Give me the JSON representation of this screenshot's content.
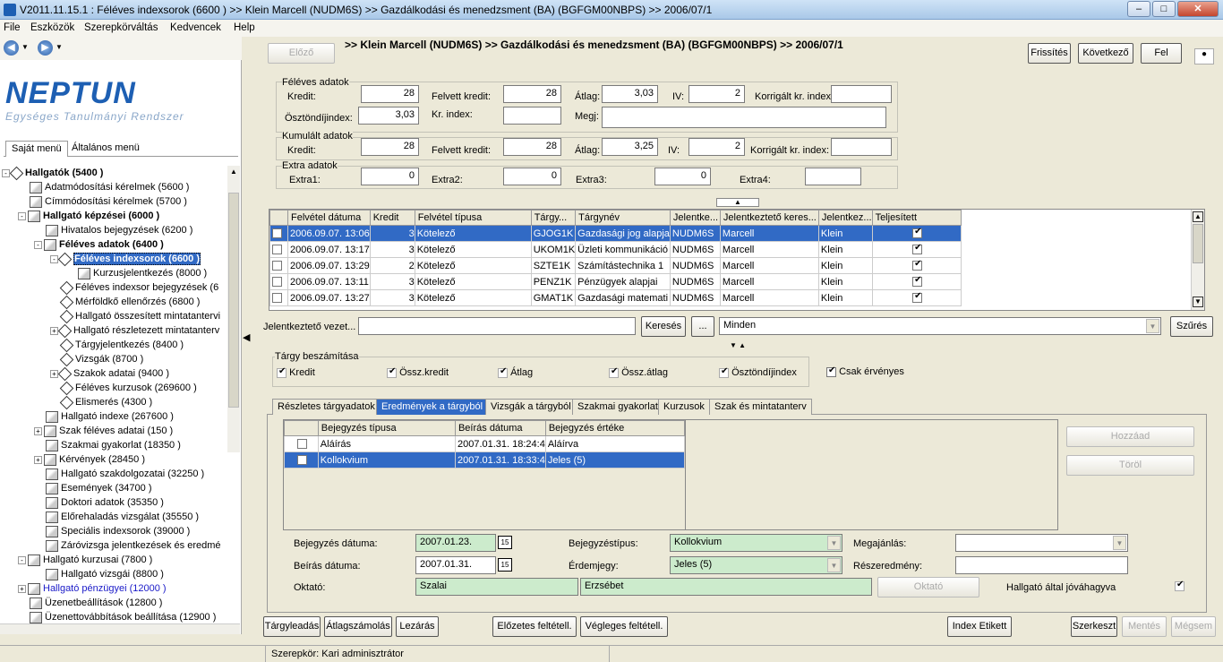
{
  "window": {
    "title": "V2011.11.15.1 : Féléves indexsorok (6600  )  >> Klein Marcell (NUDM6S)  >> Gazdálkodási és menedzsment (BA) (BGFGM00NBPS)  >> 2006/07/1"
  },
  "menu": [
    "File",
    "Eszközök",
    "Szerepkörváltás",
    "Kedvencek",
    "Help"
  ],
  "logo": {
    "name": "NEPTUN",
    "subtitle": "Egységes Tanulmányi Rendszer"
  },
  "left_tabs": [
    "Saját menü",
    "Általános menü"
  ],
  "tree": [
    {
      "label": "Hallgatók (5400  )",
      "level": 0,
      "bold": true,
      "icon": "diamond",
      "exp": "-"
    },
    {
      "label": "Adatmódosítási kérelmek (5600  )",
      "level": 1,
      "icon": "doc"
    },
    {
      "label": "Címmódosítási kérelmek (5700  )",
      "level": 1,
      "icon": "doc"
    },
    {
      "label": "Hallgató képzései (6000  )",
      "level": 1,
      "bold": true,
      "icon": "doc",
      "exp": "-"
    },
    {
      "label": "Hivatalos bejegyzések (6200  )",
      "level": 2,
      "icon": "doc"
    },
    {
      "label": "Féléves adatok (6400  )",
      "level": 2,
      "bold": true,
      "icon": "doc",
      "exp": "-"
    },
    {
      "label": "Féléves indexsorok (6600  )",
      "level": 3,
      "bold": true,
      "sel": true,
      "icon": "diamond",
      "exp": "-"
    },
    {
      "label": "Kurzusjelentkezés (8000  )",
      "level": 4,
      "icon": "doc"
    },
    {
      "label": "Féléves indexsor bejegyzések (6",
      "level": 3,
      "icon": "diamond"
    },
    {
      "label": "Mérföldkő ellenőrzés (6800  )",
      "level": 3,
      "icon": "diamond"
    },
    {
      "label": "Hallgató összesített mintatantervi",
      "level": 3,
      "icon": "diamond"
    },
    {
      "label": "Hallgató részletezett mintatanterv",
      "level": 3,
      "icon": "diamond",
      "exp": "+"
    },
    {
      "label": "Tárgyjelentkezés (8400  )",
      "level": 3,
      "icon": "diamond"
    },
    {
      "label": "Vizsgák (8700  )",
      "level": 3,
      "icon": "diamond"
    },
    {
      "label": "Szakok adatai (9400  )",
      "level": 3,
      "icon": "diamond",
      "exp": "+"
    },
    {
      "label": "Féléves kurzusok (269600  )",
      "level": 3,
      "icon": "diamond"
    },
    {
      "label": "Elismerés (4300  )",
      "level": 3,
      "icon": "diamond"
    },
    {
      "label": "Hallgató indexe (267600  )",
      "level": 2,
      "icon": "doc"
    },
    {
      "label": "Szak féléves adatai (150  )",
      "level": 2,
      "icon": "doc",
      "exp": "+"
    },
    {
      "label": "Szakmai gyakorlat (18350  )",
      "level": 2,
      "icon": "doc"
    },
    {
      "label": "Kérvények (28450  )",
      "level": 2,
      "icon": "doc",
      "exp": "+"
    },
    {
      "label": "Hallgató szakdolgozatai (32250  )",
      "level": 2,
      "icon": "doc"
    },
    {
      "label": "Események (34700  )",
      "level": 2,
      "icon": "doc"
    },
    {
      "label": "Doktori adatok (35350  )",
      "level": 2,
      "icon": "doc"
    },
    {
      "label": "Előrehaladás vizsgálat (35550  )",
      "level": 2,
      "icon": "doc"
    },
    {
      "label": "Speciális indexsorok (39000  )",
      "level": 2,
      "icon": "doc"
    },
    {
      "label": "Záróvizsga jelentkezések és eredmé",
      "level": 2,
      "icon": "doc"
    },
    {
      "label": "Hallgató kurzusai (7800  )",
      "level": 1,
      "icon": "doc",
      "exp": "-"
    },
    {
      "label": "Hallgató vizsgái (8800  )",
      "level": 2,
      "icon": "doc"
    },
    {
      "label": "Hallgató pénzügyei (12000  )",
      "level": 1,
      "icon": "doc",
      "exp": "+",
      "blue": true
    },
    {
      "label": "Üzenetbeállítások (12800  )",
      "level": 1,
      "icon": "doc"
    },
    {
      "label": "Üzenettovábbítások beállítása (12900  )",
      "level": 1,
      "icon": "doc"
    }
  ],
  "header": {
    "prev": "Előző",
    "path": ">> Klein Marcell (NUDM6S) >> Gazdálkodási és menedzsment (BA) (BGFGM00NBPS) >> 2006/07/1",
    "refresh": "Frissítés",
    "next": "Következő",
    "up": "Fel"
  },
  "feleves": {
    "legend": "Féléves adatok",
    "kredit_l": "Kredit:",
    "kredit": "28",
    "felvett_l": "Felvett kredit:",
    "felvett": "28",
    "atlag_l": "Átlag:",
    "atlag": "3,03",
    "iv_l": "IV:",
    "iv": "2",
    "korr_l": "Korrigált kr. index:",
    "korr": "",
    "oszt_l": "Ösztöndíjindex:",
    "oszt": "3,03",
    "krindex_l": "Kr. index:",
    "krindex": "",
    "megj_l": "Megj:",
    "megj": ""
  },
  "kumulalt": {
    "legend": "Kumulált adatok",
    "kredit_l": "Kredit:",
    "kredit": "28",
    "felvett_l": "Felvett kredit:",
    "felvett": "28",
    "atlag_l": "Átlag:",
    "atlag": "3,25",
    "iv_l": "IV:",
    "iv": "2",
    "korr_l": "Korrigált kr. index:",
    "korr": ""
  },
  "extra": {
    "legend": "Extra adatok",
    "e1_l": "Extra1:",
    "e1": "0",
    "e2_l": "Extra2:",
    "e2": "0",
    "e3_l": "Extra3:",
    "e3": "0",
    "e4_l": "Extra4:",
    "e4": ""
  },
  "grid": {
    "columns": [
      "",
      "Felvétel dátuma",
      "Kredit",
      "Felvétel típusa",
      "Tárgy...",
      "Tárgynév",
      "Jelentke...",
      "Jelentkeztető keres...",
      "Jelentkez...",
      "Teljesített"
    ],
    "rows": [
      {
        "date": "2006.09.07. 13:06",
        "kredit": "3",
        "tipus": "Kötelező",
        "kod": "GJOG1K",
        "nev": "Gazdasági jog alapja",
        "jel": "NUDM6S",
        "ker": "Marcell",
        "csal": "Klein",
        "sel": true
      },
      {
        "date": "2006.09.07. 13:17",
        "kredit": "3",
        "tipus": "Kötelező",
        "kod": "UKOM1K",
        "nev": "Üzleti kommunikáció",
        "jel": "NUDM6S",
        "ker": "Marcell",
        "csal": "Klein"
      },
      {
        "date": "2006.09.07. 13:29",
        "kredit": "2",
        "tipus": "Kötelező",
        "kod": "SZTE1K",
        "nev": "Számítástechnika 1",
        "jel": "NUDM6S",
        "ker": "Marcell",
        "csal": "Klein"
      },
      {
        "date": "2006.09.07. 13:11",
        "kredit": "3",
        "tipus": "Kötelező",
        "kod": "PENZ1K",
        "nev": "Pénzügyek alapjai",
        "jel": "NUDM6S",
        "ker": "Marcell",
        "csal": "Klein"
      },
      {
        "date": "2006.09.07. 13:27",
        "kredit": "3",
        "tipus": "Kötelező",
        "kod": "GMAT1K",
        "nev": "Gazdasági matemati",
        "jel": "NUDM6S",
        "ker": "Marcell",
        "csal": "Klein"
      }
    ]
  },
  "filter": {
    "label": "Jelentkeztető vezet...",
    "value": "",
    "search": "Keresés",
    "dots": "...",
    "minden": "Minden",
    "szures": "Szűrés"
  },
  "targy": {
    "legend": "Tárgy beszámítása",
    "kredit": "Kredit",
    "osszkredit": "Össz.kredit",
    "atlag": "Átlag",
    "osszatlag": "Össz.átlag",
    "osztondij": "Ösztöndíjindex",
    "csak": "Csak érvényes"
  },
  "subtabs": [
    "Részletes tárgyadatok",
    "Eredmények a tárgyból",
    "Vizsgák a tárgyból",
    "Szakmai gyakorlat",
    "Kurzusok",
    "Szak és mintatanterv"
  ],
  "bgrid": {
    "columns": [
      "",
      "Bejegyzés típusa",
      "Beírás dátuma",
      "Bejegyzés értéke"
    ],
    "rows": [
      {
        "tipus": "Aláírás",
        "datum": "2007.01.31. 18:24:4",
        "ertek": "Aláírva"
      },
      {
        "tipus": "Kollokvium",
        "datum": "2007.01.31. 18:33:4",
        "ertek": "Jeles (5)",
        "sel": true
      }
    ]
  },
  "side_btns": {
    "add": "Hozzáad",
    "del": "Töröl"
  },
  "form": {
    "bej_datum_l": "Bejegyzés dátuma:",
    "bej_datum": "2007.01.23.",
    "beir_datum_l": "Beírás dátuma:",
    "beir_datum": "2007.01.31.",
    "bej_tipus_l": "Bejegyzéstípus:",
    "bej_tipus": "Kollokvium",
    "erdemjegy_l": "Érdemjegy:",
    "erdemjegy": "Jeles (5)",
    "megajanlas_l": "Megajánlás:",
    "megajanlas": "",
    "reszered_l": "Részeredmény:",
    "reszered": "",
    "oktato_l": "Oktató:",
    "oktato_v": "Szalai",
    "oktato_k": "Erzsébet",
    "oktato_btn": "Oktató",
    "jovahagy_l": "Hallgató által jóváhagyva",
    "cal": "15"
  },
  "bottom": {
    "targyleadas": "Tárgyleadás",
    "atlagszamolas": "Átlagszámolás",
    "lezaras": "Lezárás",
    "elozetes": "Előzetes feltétell.",
    "vegleges": "Végleges feltétell.",
    "index": "Index Etikett",
    "szerkeszt": "Szerkeszt",
    "mentes": "Mentés",
    "megsem": "Mégsem"
  },
  "status": {
    "role": "Szerepkör: Kari adminisztrátor"
  }
}
